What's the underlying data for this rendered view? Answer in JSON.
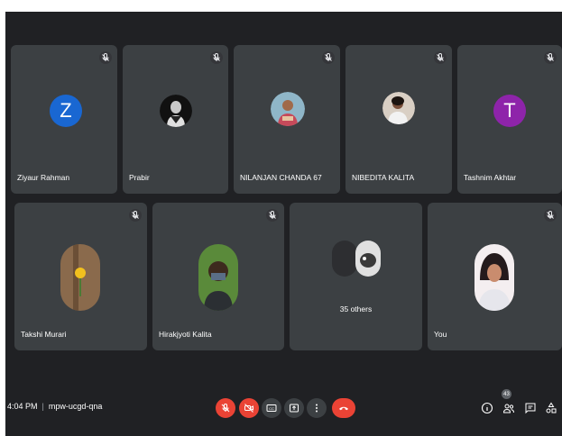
{
  "participants": [
    {
      "name": "Ziyaur Rahman",
      "initial": "Z",
      "avatar_color": "#1967d2",
      "muted": true
    },
    {
      "name": "Prabir",
      "muted": true
    },
    {
      "name": "NILANJAN CHANDA 67",
      "muted": true
    },
    {
      "name": "NIBEDITA KALITA",
      "muted": true
    },
    {
      "name": "Tashnim Akhtar",
      "initial": "T",
      "avatar_color": "#8e24aa",
      "muted": true
    },
    {
      "name": "Takshi Murari",
      "muted": true
    },
    {
      "name": "Hirakjyoti Kalita",
      "muted": true
    },
    {
      "name": "You"
    }
  ],
  "others_tile": {
    "label": "35 others"
  },
  "meeting": {
    "time": "4:04 PM",
    "code": "mpw-ucgd-qna"
  },
  "controls": {
    "mic": "mic-off-icon",
    "camera": "camera-off-icon",
    "captions": "closed-captions-icon",
    "present": "present-screen-icon",
    "more": "more-options-icon",
    "leave": "end-call-icon",
    "end_call_color": "#ea4335"
  },
  "right_controls": {
    "people_count": "43",
    "items": [
      "info-icon",
      "people-icon",
      "chat-icon",
      "activities-icon"
    ]
  },
  "colors": {
    "background": "#202124",
    "tile": "#3c4043"
  }
}
